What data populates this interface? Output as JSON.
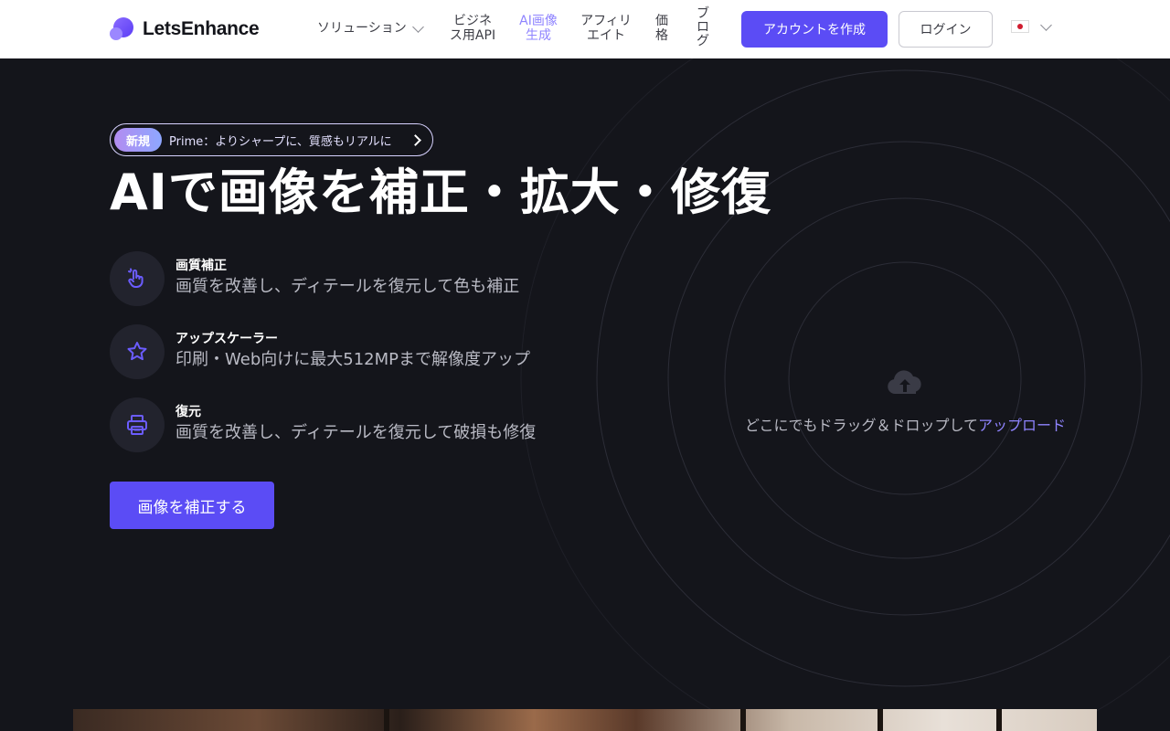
{
  "header": {
    "logo_text": "LetsEnhance",
    "nav": {
      "solutions": "ソリューション",
      "business_api_line1": "ビジネ",
      "business_api_line2": "ス用API",
      "ai_image_line1": "AI画像",
      "ai_image_line2": "生成",
      "affiliate_line1": "アフィリ",
      "affiliate_line2": "エイト",
      "price_line1": "価",
      "price_line2": "格",
      "blog_line1": "ブ",
      "blog_line2": "ロ",
      "blog_line3": "グ"
    },
    "create_account": "アカウントを作成",
    "login": "ログイン",
    "language_icon": "japan-flag-icon"
  },
  "hero": {
    "badge_label": "新規",
    "badge_text": "Prime：よりシャープに、質感もリアルに",
    "title": "AIで画像を補正・拡大・修復",
    "features": [
      {
        "title": "画質補正",
        "description": "画質を改善し、ディテールを復元して色も補正",
        "icon": "hand-sparkle-icon"
      },
      {
        "title": "アップスケーラー",
        "description": "印刷・Web向けに最大512MPまで解像度アップ",
        "icon": "star-icon"
      },
      {
        "title": "復元",
        "description": "画質を改善し、ディテールを復元して破損も修復",
        "icon": "printer-icon"
      }
    ],
    "cta": "画像を補正する"
  },
  "upload": {
    "text": "どこにでもドラッグ＆ドロップして",
    "link": "アップロード",
    "icon": "cloud-upload-icon"
  },
  "colors": {
    "accent": "#5b4cf5",
    "link": "#8f84ff",
    "background": "#14151b"
  }
}
